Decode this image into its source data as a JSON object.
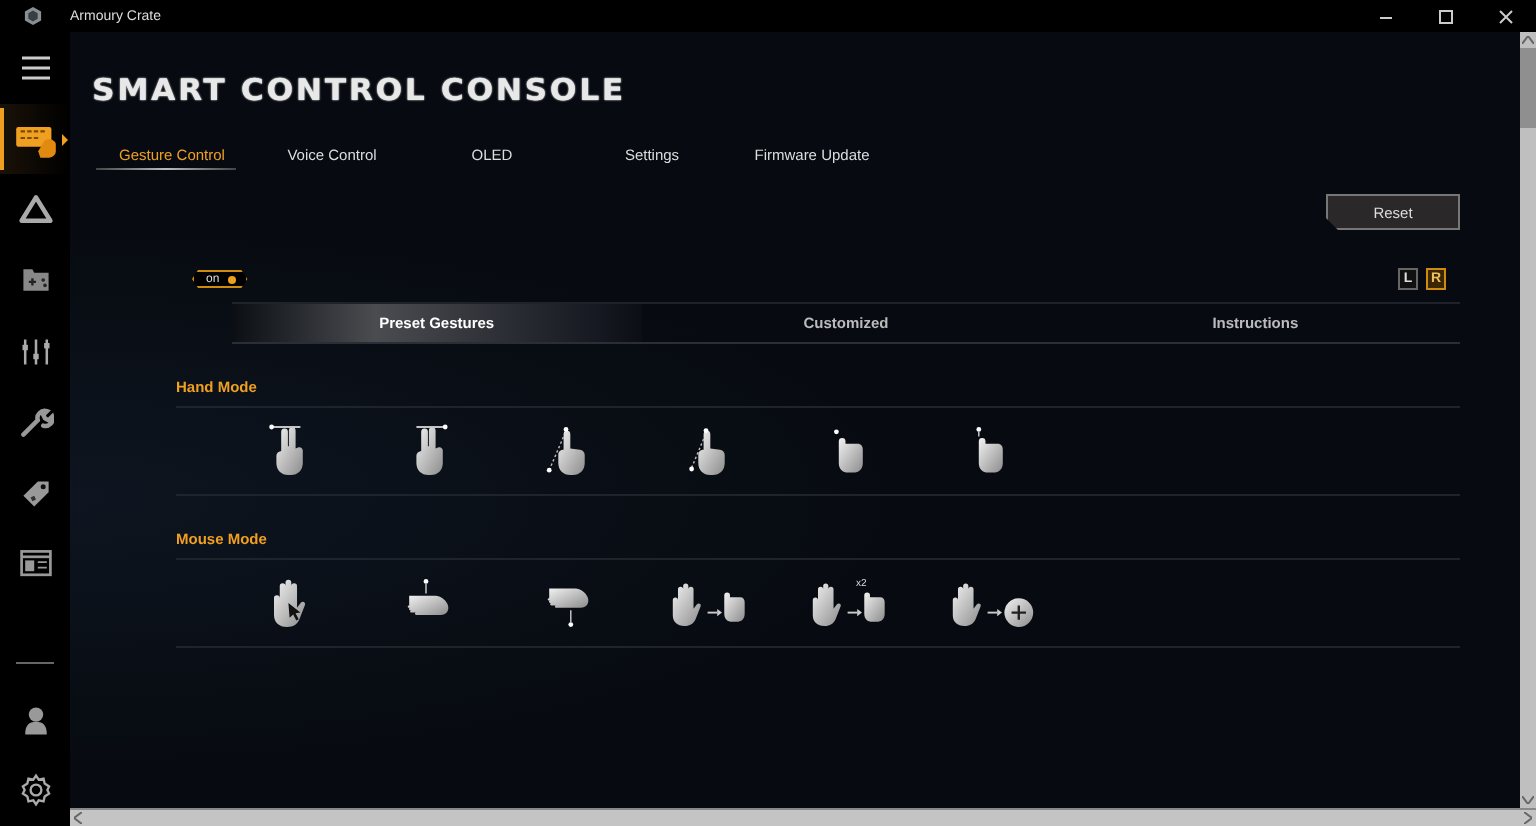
{
  "window": {
    "title": "Armoury Crate"
  },
  "sidebar": {
    "items": [
      {
        "kind": "keyboard",
        "selected": true
      },
      {
        "kind": "triangle",
        "selected": false
      },
      {
        "kind": "gamepad",
        "selected": false
      },
      {
        "kind": "sliders",
        "selected": false
      },
      {
        "kind": "wrench",
        "selected": false
      },
      {
        "kind": "tag",
        "selected": false
      },
      {
        "kind": "window",
        "selected": false
      }
    ],
    "bottom_items": [
      {
        "kind": "user"
      },
      {
        "kind": "gear"
      }
    ]
  },
  "page": {
    "title": "SMART CONTROL CONSOLE"
  },
  "tabs": [
    {
      "label": "Gesture Control",
      "selected": true
    },
    {
      "label": "Voice Control",
      "selected": false
    },
    {
      "label": "OLED",
      "selected": false
    },
    {
      "label": "Settings",
      "selected": false
    },
    {
      "label": "Firmware Update",
      "selected": false
    }
  ],
  "reset_button": "Reset",
  "toggle": {
    "label": "on",
    "on": true
  },
  "hand_selector": [
    {
      "label": "L",
      "selected": false
    },
    {
      "label": "R",
      "selected": true
    }
  ],
  "subtabs": [
    {
      "label": "Preset Gestures",
      "selected": true
    },
    {
      "label": "Customized",
      "selected": false
    },
    {
      "label": "Instructions",
      "selected": false
    }
  ],
  "sections": [
    {
      "title": "Hand Mode",
      "gestures": [
        {
          "kind": "swipe-left"
        },
        {
          "kind": "swipe-right"
        },
        {
          "kind": "diagonal-up"
        },
        {
          "kind": "diagonal-down"
        },
        {
          "kind": "tap"
        },
        {
          "kind": "tap-down"
        }
      ]
    },
    {
      "title": "Mouse Mode",
      "gestures": [
        {
          "kind": "cursor"
        },
        {
          "kind": "move-up"
        },
        {
          "kind": "move-down"
        },
        {
          "kind": "grab"
        },
        {
          "kind": "grab",
          "badge": "x2"
        },
        {
          "kind": "zoom"
        }
      ]
    }
  ]
}
